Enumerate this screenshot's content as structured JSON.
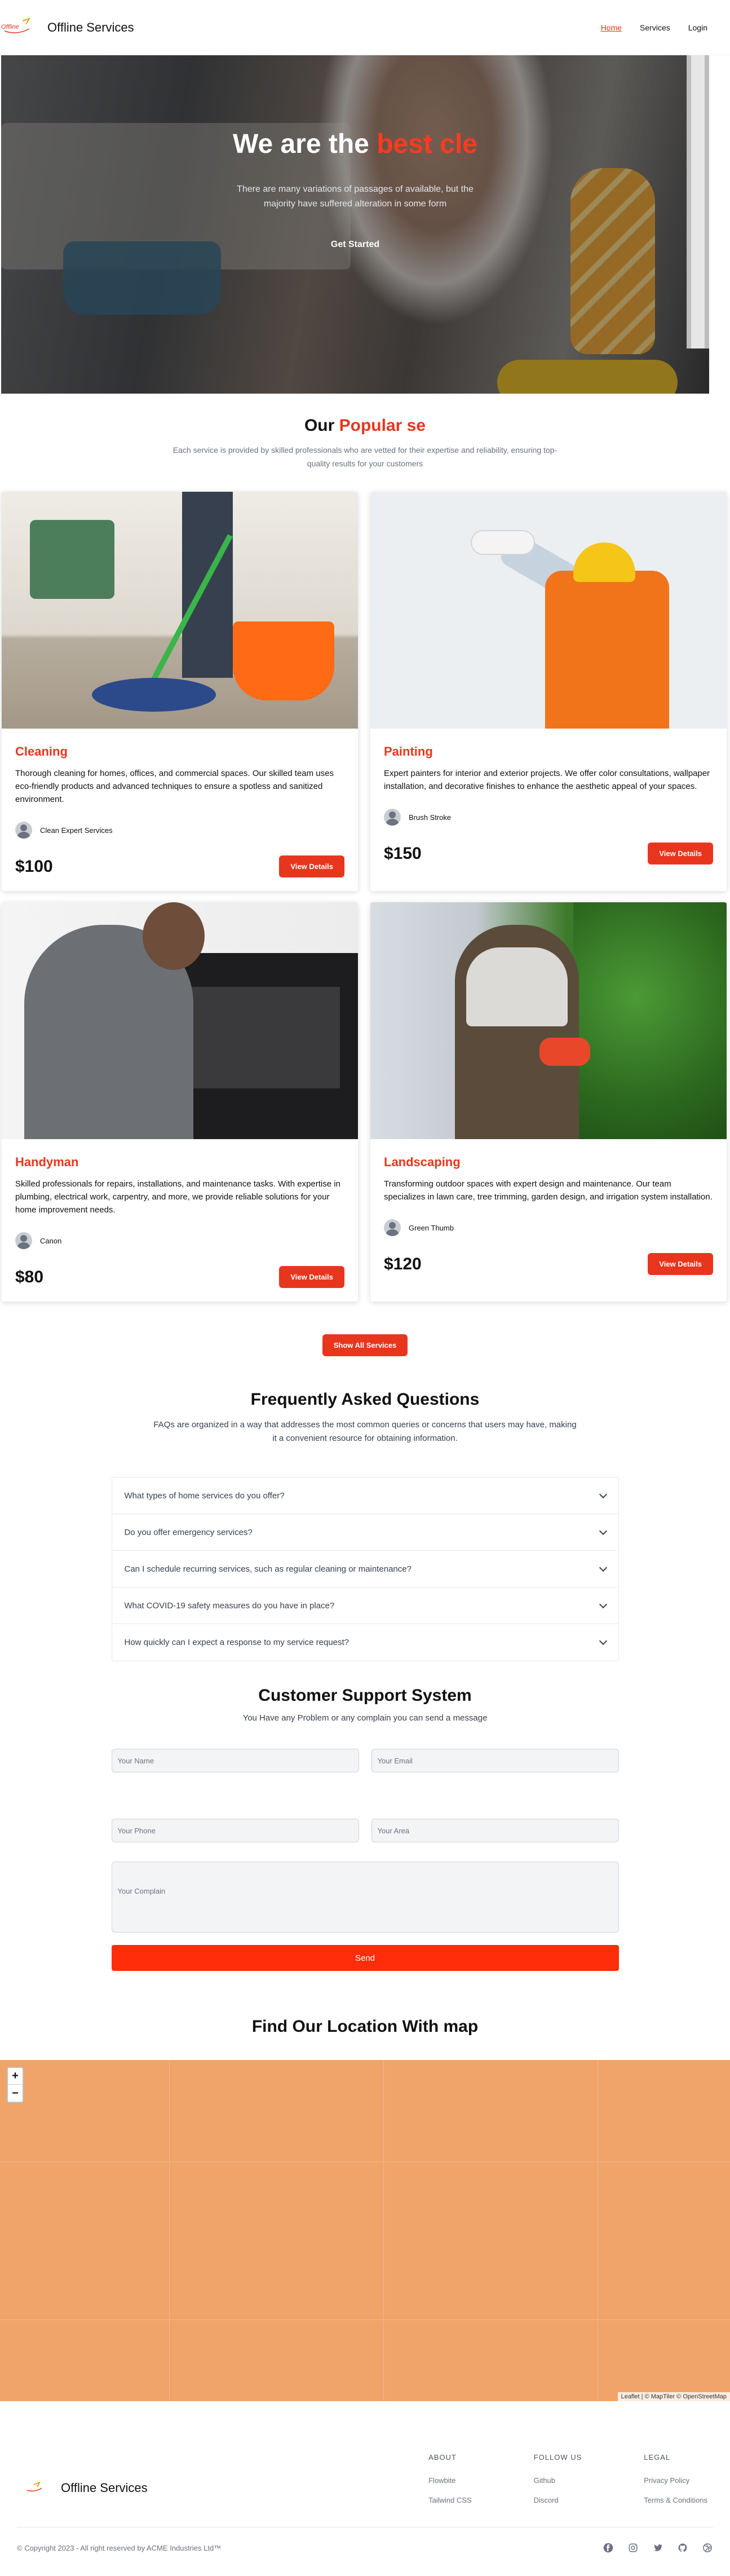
{
  "nav": {
    "brand": "Offline Services",
    "logo_text": "Offline",
    "links": [
      "Home",
      "Services",
      "Login"
    ]
  },
  "hero": {
    "title_main": "We are the",
    "title_accent": "best cle",
    "subtitle": "There are many variations of passages of available, but the majority have suffered alteration in some form",
    "cta": "Get Started"
  },
  "popular": {
    "title_main": "Our",
    "title_accent": "Popular se",
    "subtitle": "Each service is provided by skilled professionals who are vetted for their expertise and reliability, ensuring top-quality results for your customers",
    "show_all": "Show All Services",
    "cards": [
      {
        "title": "Cleaning",
        "desc": "Thorough cleaning for homes, offices, and commercial spaces. Our skilled team uses eco-friendly products and advanced techniques to ensure a spotless and sanitized environment.",
        "provider": "Clean Expert Services",
        "price": "$100",
        "button": "View Details"
      },
      {
        "title": "Painting",
        "desc": "Expert painters for interior and exterior projects. We offer color consultations, wallpaper installation, and decorative finishes to enhance the aesthetic appeal of your spaces.",
        "provider": "Brush Stroke",
        "price": "$150",
        "button": "View Details"
      },
      {
        "title": "Handyman",
        "desc": "Skilled professionals for repairs, installations, and maintenance tasks. With expertise in plumbing, electrical work, carpentry, and more, we provide reliable solutions for your home improvement needs.",
        "provider": "Canon",
        "price": "$80",
        "button": "View Details"
      },
      {
        "title": "Landscaping",
        "desc": "Transforming outdoor spaces with expert design and maintenance. Our team specializes in lawn care, tree trimming, garden design, and irrigation system installation.",
        "provider": "Green Thumb",
        "price": "$120",
        "button": "View Details"
      }
    ]
  },
  "faq": {
    "title": "Frequently Asked Questions",
    "subtitle": "FAQs are organized in a way that addresses the most common queries or concerns that users may have, making it a convenient resource for obtaining information.",
    "items": [
      "What types of home services do you offer?",
      "Do you offer emergency services?",
      "Can I schedule recurring services, such as regular cleaning or maintenance?",
      "What COVID-19 safety measures do you have in place?",
      "How quickly can I expect a response to my service request?"
    ]
  },
  "support": {
    "title": "Customer Support System",
    "subtitle": "You Have any Problem or any complain you can send a message",
    "name_placeholder": "Your Name",
    "email_placeholder": "Your Email",
    "phone_placeholder": "Your Phone",
    "area_placeholder": "Your Area",
    "complain_placeholder": "Your Complain",
    "send": "Send"
  },
  "map": {
    "title": "Find Our Location With map",
    "zoom_in": "+",
    "zoom_out": "−",
    "attribution": "Leaflet | © MapTiler © OpenStreetMap",
    "fill_color": "#f0a46a"
  },
  "footer": {
    "brand": "Offline Services",
    "columns": [
      {
        "heading": "ABOUT",
        "links": [
          "Flowbite",
          "Tailwind CSS"
        ]
      },
      {
        "heading": "FOLLOW US",
        "links": [
          "Github",
          "Discord"
        ]
      },
      {
        "heading": "LEGAL",
        "links": [
          "Privacy Policy",
          "Terms & Conditions"
        ]
      }
    ],
    "copyright": "© Copyright 2023 - All right reserved by ACME Industries Ltd™",
    "socials": [
      "facebook-icon",
      "instagram-icon",
      "twitter-icon",
      "github-icon",
      "dribbble-icon"
    ]
  },
  "colors": {
    "accent": "#e8361e",
    "send_button": "#ff2d0a"
  }
}
